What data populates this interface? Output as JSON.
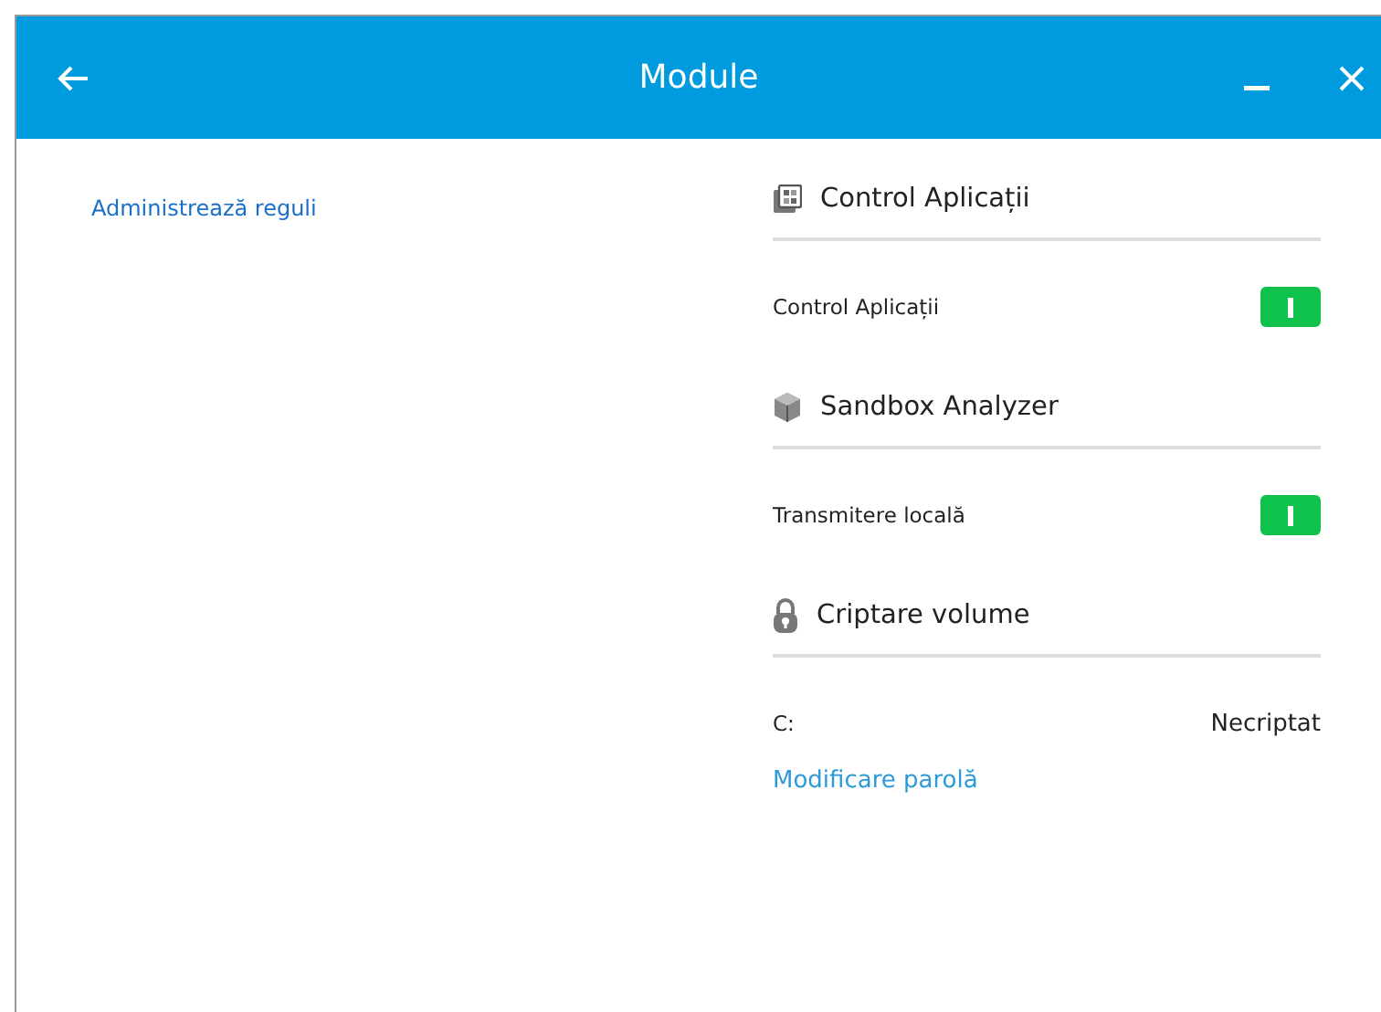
{
  "window": {
    "title": "Module"
  },
  "sidebar": {
    "link": "Administrează reguli"
  },
  "sections": [
    {
      "title": "Control Aplicații",
      "kind": "apps",
      "rows": [
        {
          "kind": "toggle",
          "label": "Control Aplicații",
          "on": true
        }
      ]
    },
    {
      "title": "Sandbox Analyzer",
      "kind": "box",
      "rows": [
        {
          "kind": "toggle",
          "label": "Transmitere locală",
          "on": true
        }
      ]
    },
    {
      "title": "Criptare volume",
      "kind": "lock",
      "rows": [
        {
          "kind": "value",
          "label": "C:",
          "value": "Necriptat"
        },
        {
          "kind": "link",
          "label": "Modificare parolă"
        }
      ]
    }
  ]
}
